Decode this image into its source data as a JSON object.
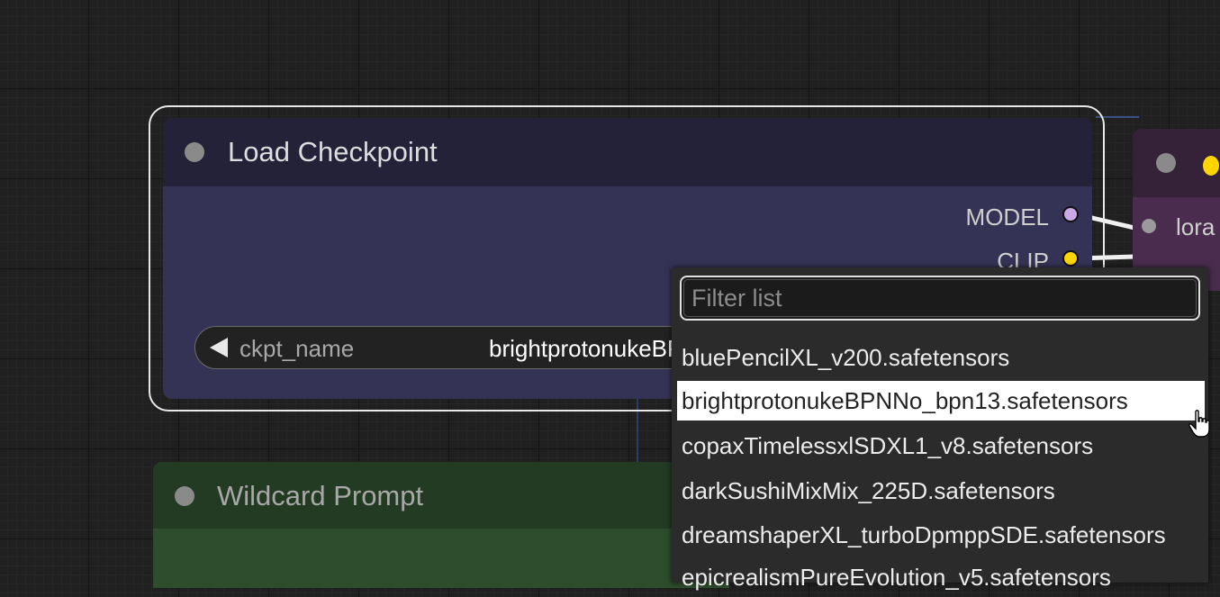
{
  "nodes": {
    "load_checkpoint": {
      "title": "Load Checkpoint",
      "outputs": [
        {
          "label": "MODEL",
          "color": "#c9a9e6"
        },
        {
          "label": "CLIP",
          "color": "#ffd500"
        }
      ],
      "widget": {
        "name": "ckpt_name",
        "value": "brightprotonukeBPNNo_bpn13.safetensors"
      }
    },
    "lora": {
      "title_fragment": "",
      "input_label": "lora"
    },
    "wildcard": {
      "title": "Wildcard Prompt"
    }
  },
  "dropdown": {
    "filter_placeholder": "Filter list",
    "options": [
      "bluePencilXL_v200.safetensors",
      "brightprotonukeBPNNo_bpn13.safetensors",
      "copaxTimelessxlSDXL1_v8.safetensors",
      "darkSushiMixMix_225D.safetensors",
      "dreamshaperXL_turboDpmppSDE.safetensors",
      "epicrealismPureEvolution_v5.safetensors"
    ],
    "hovered_index": 1
  },
  "colors": {
    "canvas_bg": "#202020",
    "checkpoint_title_bg": "#232239",
    "checkpoint_body_bg": "#353355",
    "lora_body_bg": "#4a2d4e",
    "wildcard_body_bg": "#2d4d2d",
    "model_slot": "#c9a9e6",
    "clip_slot": "#ffd500"
  },
  "icons": {
    "widget_arrow": "left-arrow-icon",
    "cursor": "hand-pointer-icon"
  }
}
